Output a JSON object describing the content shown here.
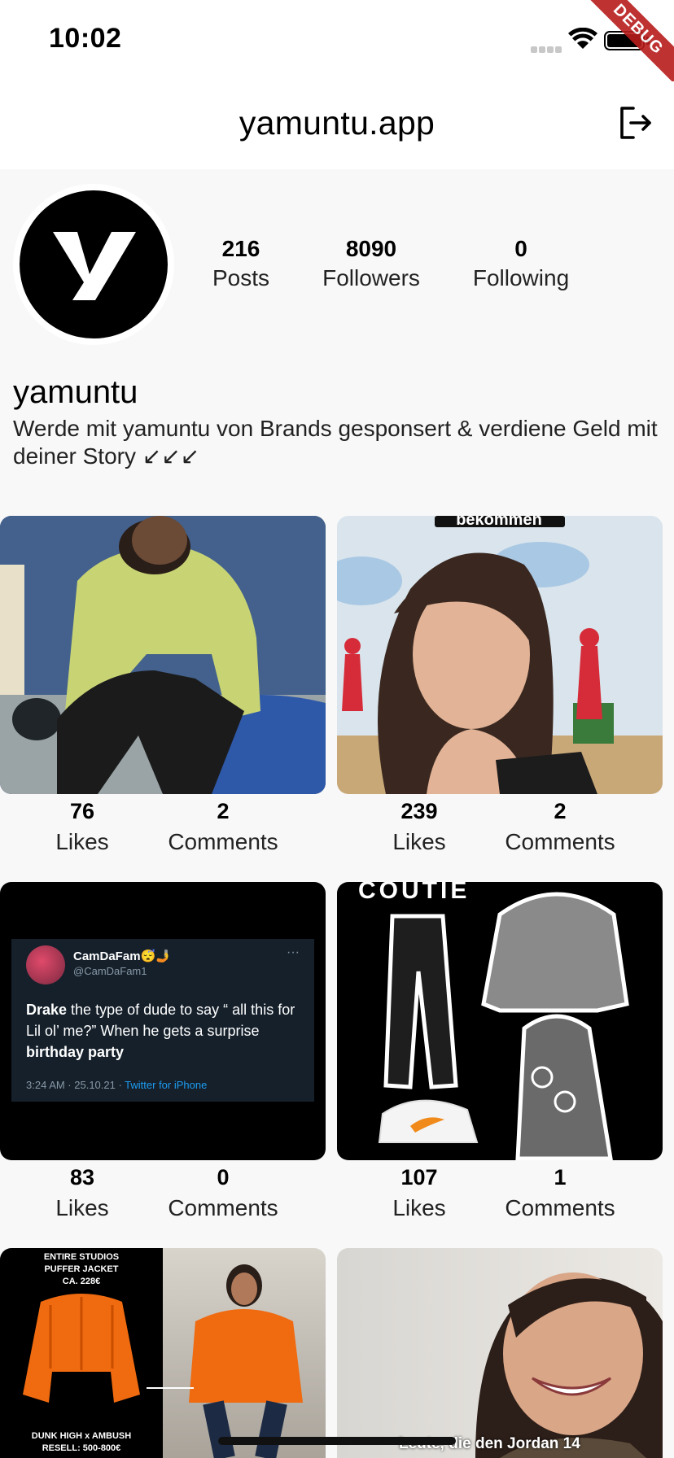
{
  "status_bar": {
    "time": "10:02",
    "debug_label": "DEBUG"
  },
  "header": {
    "title": "yamuntu.app",
    "logout_icon": "logout-icon"
  },
  "profile": {
    "avatar_letter": "y",
    "stats": [
      {
        "value": "216",
        "label": "Posts"
      },
      {
        "value": "8090",
        "label": "Followers"
      },
      {
        "value": "0",
        "label": "Following"
      }
    ],
    "name": "yamuntu",
    "bio": "Werde mit yamuntu von Brands gesponsert & verdiene Geld mit deiner Story ↙↙↙"
  },
  "posts": [
    {
      "likes": "76",
      "likes_label": "Likes",
      "comments": "2",
      "comments_label": "Comments"
    },
    {
      "likes": "239",
      "likes_label": "Likes",
      "comments": "2",
      "comments_label": "Comments",
      "overlay_text": "bekommen"
    },
    {
      "likes": "83",
      "likes_label": "Likes",
      "comments": "0",
      "comments_label": "Comments",
      "tweet": {
        "name": "CamDaFam😴🤳",
        "handle": "@CamDaFam1",
        "more": "···",
        "text_a": "Drake",
        "text_b": " the type of dude to say “ all this for Lil ol’ me?” When he gets a surprise ",
        "text_c": "birthday party",
        "meta": "3:24 AM · 25.10.21 · ",
        "source": "Twitter for iPhone"
      }
    },
    {
      "likes": "107",
      "likes_label": "Likes",
      "comments": "1",
      "comments_label": "Comments",
      "overlay_text": "COUTIE"
    },
    {
      "overlay_top": "ENTIRE STUDIOS\nPUFFER JACKET\nCA. 228€",
      "overlay_bottom": "DUNK HIGH x AMBUSH\nRESELL: 500-800€"
    },
    {
      "overlay_text": "Leute, die den Jordan 14"
    }
  ],
  "colors": {
    "background": "#f8f8f8",
    "accent": "#1d9bf0",
    "debug": "#b71c1c"
  }
}
